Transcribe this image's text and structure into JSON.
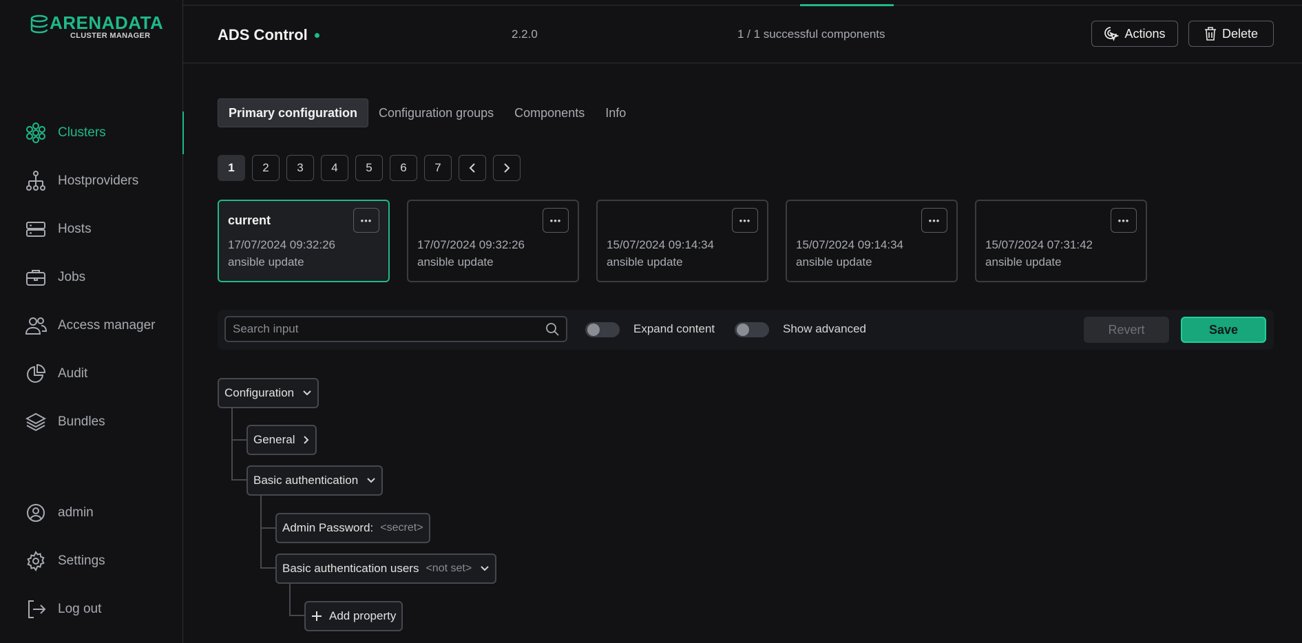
{
  "brand": {
    "name": "ARENADATA",
    "subtitle": "CLUSTER MANAGER",
    "accent_color": "#1fb98a"
  },
  "sidebar": {
    "items": [
      {
        "label": "Clusters",
        "icon": "clusters-icon",
        "active": true
      },
      {
        "label": "Hostproviders",
        "icon": "hierarchy-icon",
        "active": false
      },
      {
        "label": "Hosts",
        "icon": "server-icon",
        "active": false
      },
      {
        "label": "Jobs",
        "icon": "briefcase-icon",
        "active": false
      },
      {
        "label": "Access manager",
        "icon": "users-icon",
        "active": false
      },
      {
        "label": "Audit",
        "icon": "pie-chart-icon",
        "active": false
      },
      {
        "label": "Bundles",
        "icon": "layers-icon",
        "active": false
      }
    ],
    "bottom_items": [
      {
        "label": "admin",
        "icon": "user-circle-icon"
      },
      {
        "label": "Settings",
        "icon": "gear-icon"
      },
      {
        "label": "Log out",
        "icon": "logout-icon"
      }
    ]
  },
  "header": {
    "title": "ADS Control",
    "version": "2.2.0",
    "components_status": "1 / 1 successful components",
    "actions_label": "Actions",
    "delete_label": "Delete"
  },
  "tabs": [
    {
      "label": "Primary configuration",
      "active": true
    },
    {
      "label": "Configuration groups",
      "active": false
    },
    {
      "label": "Components",
      "active": false
    },
    {
      "label": "Info",
      "active": false
    }
  ],
  "pagination": {
    "pages": [
      "1",
      "2",
      "3",
      "4",
      "5",
      "6",
      "7"
    ],
    "current": "1"
  },
  "config_versions": [
    {
      "title": "current",
      "date": "17/07/2024 09:32:26",
      "description": "ansible update",
      "active": true
    },
    {
      "title": "",
      "date": "17/07/2024 09:32:26",
      "description": "ansible update",
      "active": false
    },
    {
      "title": "",
      "date": "15/07/2024 09:14:34",
      "description": "ansible update",
      "active": false
    },
    {
      "title": "",
      "date": "15/07/2024 09:14:34",
      "description": "ansible update",
      "active": false
    },
    {
      "title": "",
      "date": "15/07/2024 07:31:42",
      "description": "ansible update",
      "active": false
    }
  ],
  "toolbar": {
    "search_placeholder": "Search input",
    "expand_content_label": "Expand content",
    "expand_content_on": false,
    "show_advanced_label": "Show advanced",
    "show_advanced_on": false,
    "revert_label": "Revert",
    "save_label": "Save"
  },
  "tree": {
    "root": "Configuration",
    "general": "General",
    "basic_auth": "Basic authentication",
    "admin_password_label": "Admin Password:",
    "admin_password_value": "<secret>",
    "basic_auth_users_label": "Basic authentication users",
    "basic_auth_users_value": "<not set>",
    "add_property_label": "Add property"
  }
}
